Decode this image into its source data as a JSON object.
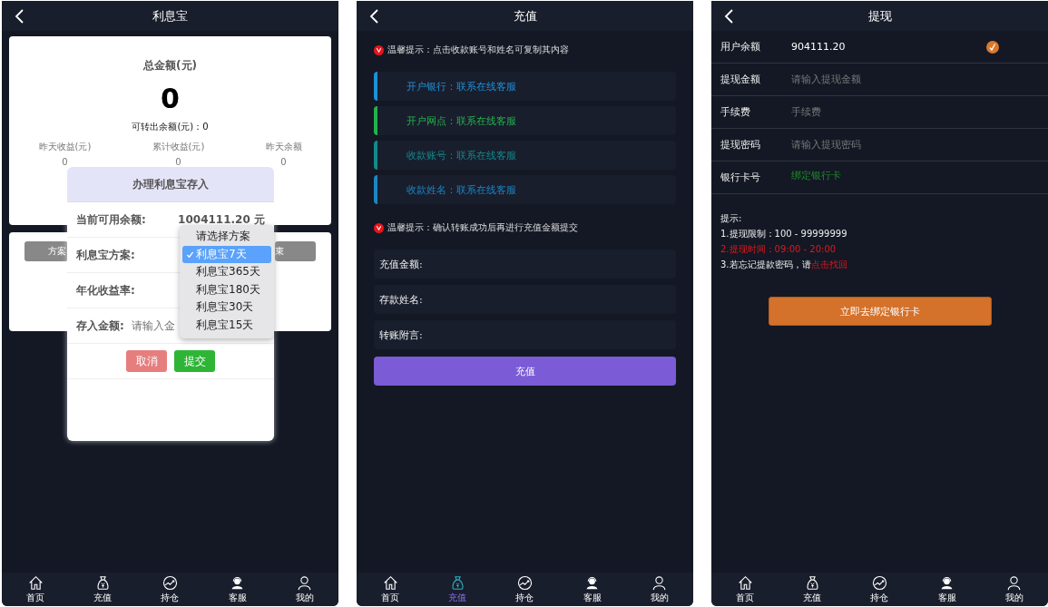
{
  "screens": [
    {
      "kind": "licai",
      "title": "利息宝",
      "summary": {
        "total_label": "总金额(元)",
        "total": "0",
        "transferable": "可转出余额(元)：0",
        "stats": [
          {
            "label": "昨天收益(元)",
            "value": "0"
          },
          {
            "label": "累计收益(元)",
            "value": "0"
          },
          {
            "label": "昨天余额",
            "value": "0"
          }
        ]
      },
      "plan_buttons": [
        "方案",
        "束"
      ],
      "modal": {
        "title": "办理利息宝存入",
        "rows": [
          {
            "kind": "value",
            "label": "当前可用余额:",
            "value": "1004111.20 元"
          },
          {
            "kind": "plain",
            "label": "利息宝方案:"
          },
          {
            "kind": "plain",
            "label": "年化收益率:"
          },
          {
            "kind": "input",
            "label": "存入金额:",
            "placeholder": "请输入金"
          }
        ],
        "cancel": "取消",
        "submit": "提交",
        "dropdown": [
          {
            "label": "请选择方案",
            "selected": false
          },
          {
            "label": "利息宝7天",
            "selected": true
          },
          {
            "label": "利息宝365天",
            "selected": false
          },
          {
            "label": "利息宝180天",
            "selected": false
          },
          {
            "label": "利息宝30天",
            "selected": false
          },
          {
            "label": "利息宝15天",
            "selected": false
          }
        ]
      },
      "nav": [
        {
          "label": "首页",
          "selected": false
        },
        {
          "label": "充值",
          "selected": false
        },
        {
          "label": "持仓",
          "selected": false
        },
        {
          "label": "客服",
          "selected": false
        },
        {
          "label": "我的",
          "selected": false
        }
      ]
    },
    {
      "kind": "recharge",
      "title": "充值",
      "tip1": "温馨提示：点击收款账号和姓名可复制其内容",
      "info": [
        {
          "text": "开户银行：联系在线客服",
          "color": "#1e90d8"
        },
        {
          "text": "开户网点：联系在线客服",
          "color": "#22b24c"
        },
        {
          "text": "收款账号：联系在线客服",
          "color": "#13898a"
        },
        {
          "text": "收款姓名：联系在线客服",
          "color": "#1a86c4"
        }
      ],
      "tip2": "温馨提示：确认转账成功后再进行充值金额提交",
      "fields": [
        "充值金额:",
        "存款姓名:",
        "转账附言:"
      ],
      "button": "充值",
      "nav": [
        {
          "label": "首页",
          "selected": false
        },
        {
          "label": "充值",
          "selected": true
        },
        {
          "label": "持仓",
          "selected": false
        },
        {
          "label": "客服",
          "selected": false
        },
        {
          "label": "我的",
          "selected": false
        }
      ]
    },
    {
      "kind": "withdraw",
      "title": "提现",
      "rows": [
        {
          "kind": "balance",
          "label": "用户余额",
          "value": "904111.20"
        },
        {
          "kind": "input",
          "label": "提现金额",
          "placeholder": "请输入提现金额"
        },
        {
          "kind": "input",
          "label": "手续费",
          "placeholder": "手续费"
        },
        {
          "kind": "input",
          "label": "提现密码",
          "placeholder": "请输入提现密码"
        },
        {
          "kind": "link",
          "label": "银行卡号",
          "value": "绑定银行卡"
        }
      ],
      "tips_title": "提示:",
      "tips": [
        {
          "kind": "plain",
          "text": "1.提现限制：100 - 99999999"
        },
        {
          "kind": "warn",
          "text": "2.提现时间：09:00 - 20:00"
        },
        {
          "kind": "link",
          "text": "3.若忘记提款密码，请",
          "link": "点击找回"
        }
      ],
      "button": "立即去绑定银行卡",
      "nav": [
        {
          "label": "首页",
          "selected": false
        },
        {
          "label": "充值",
          "selected": false
        },
        {
          "label": "持仓",
          "selected": false
        },
        {
          "label": "客服",
          "selected": false
        },
        {
          "label": "我的",
          "selected": false
        }
      ]
    }
  ]
}
